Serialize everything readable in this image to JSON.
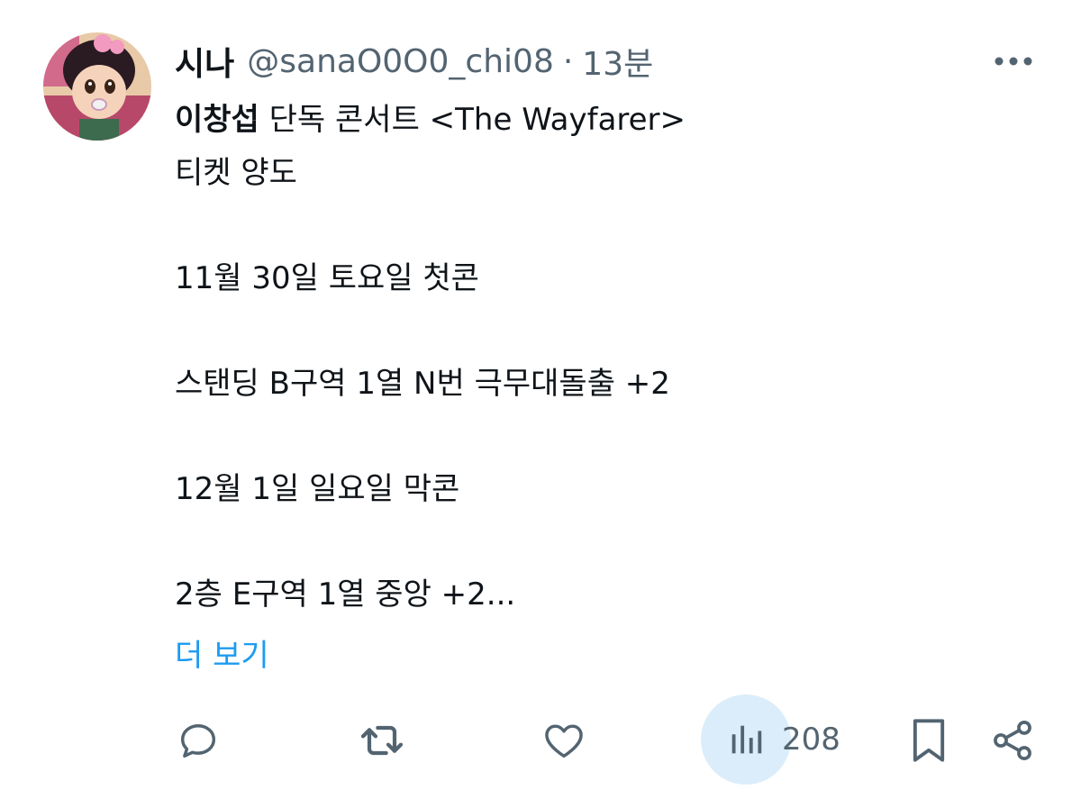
{
  "author": {
    "display_name": "시나",
    "handle": "@sanaO0O0_chi08",
    "separator": "·",
    "time": "13분"
  },
  "post": {
    "line1_bold": "이창섭",
    "line1_rest": " 단독 콘서트 <The Wayfarer>",
    "line2": "티켓 양도",
    "line3": "11월 30일 토요일 첫콘",
    "line4": "스탠딩 B구역 1열 N번 극무대돌출 +2",
    "line5": "12월 1일 일요일 막콘",
    "line6": "2층 E구역 1열 중앙 +2..."
  },
  "show_more_label": "더 보기",
  "actions": {
    "views_count": "208"
  },
  "colors": {
    "text": "#0f1419",
    "muted": "#536471",
    "link": "#1d9bf0",
    "views_highlight": "#dbedfa"
  },
  "icons": [
    "avatar",
    "more-icon",
    "reply-icon",
    "retweet-icon",
    "like-icon",
    "views-icon",
    "bookmark-icon",
    "share-icon"
  ]
}
